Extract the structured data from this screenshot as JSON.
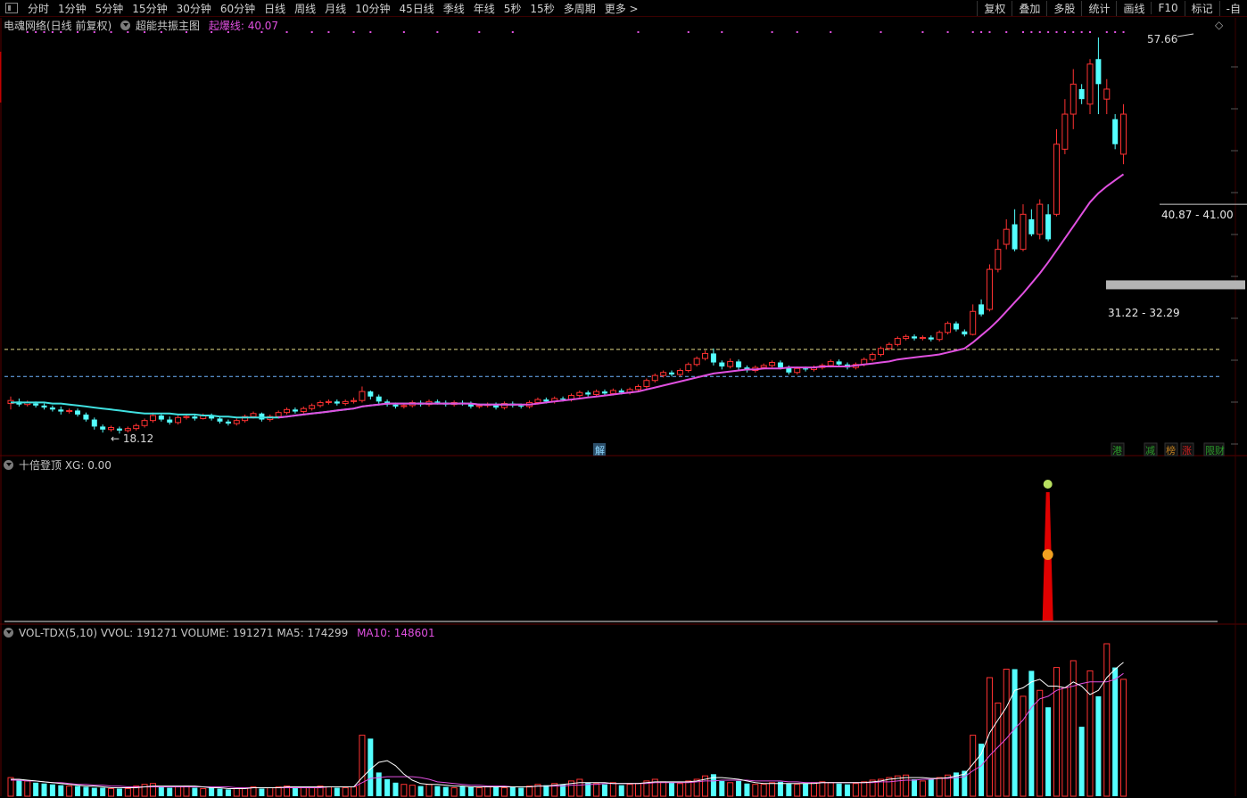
{
  "toolbar": {
    "periods": [
      "分时",
      "1分钟",
      "5分钟",
      "15分钟",
      "30分钟",
      "60分钟",
      "日线",
      "周线",
      "月线",
      "10分钟",
      "45日线",
      "季线",
      "年线",
      "5秒",
      "15秒",
      "多周期",
      "更多 >"
    ],
    "right_items": [
      "复权",
      "叠加",
      "多股",
      "统计",
      "画线",
      "F10",
      "标记",
      "-自"
    ]
  },
  "main_panel": {
    "stock_label": "电魂网络(日线 前复权)",
    "indicator_name": "超能共振主图",
    "indicator_value_label": "起爆线: 40.07"
  },
  "sub_panel": {
    "indicator_label": "十倍登顶  XG: 0.00"
  },
  "volume_panel": {
    "label_main": "VOL-TDX(5,10)  VVOL: 191271  VOLUME: 191271  MA5: 174299",
    "label_ma10": "MA10: 148601"
  },
  "markers": {
    "bottom_left": "解",
    "bottom_right": [
      "港",
      "减",
      "榜",
      "涨",
      "限财"
    ]
  },
  "colors": {
    "up": "#ff3232",
    "down": "#54ffff",
    "ma_pink": "#e050e0",
    "ma_cyan": "#40e0e0",
    "dash_yellow": "#e8e08a",
    "dash_cyan": "#6fb6ff",
    "zone_gray": "#b4b4b4",
    "vol_ma5": "#ffffff",
    "vol_ma10": "#e050e0",
    "label_magenta": "#e050e0"
  },
  "chart_data": {
    "type": "candlestick",
    "price_annotations": {
      "high_label": "57.66",
      "low_label": "18.12",
      "zone_upper": "40.87 - 41.00",
      "zone_lower": "31.22 - 32.29"
    },
    "ylim": [
      15,
      60
    ],
    "reference_lines": [
      26.5,
      23.8
    ],
    "candles": [
      [
        21.1,
        21.4,
        20.5,
        21.8
      ],
      [
        21.3,
        21.0,
        20.8,
        21.6
      ],
      [
        21.0,
        21.2,
        20.8,
        21.4
      ],
      [
        21.1,
        20.9,
        20.7,
        21.3
      ],
      [
        20.9,
        20.7,
        20.5,
        21.1
      ],
      [
        20.7,
        20.5,
        20.3,
        20.9
      ],
      [
        20.5,
        20.3,
        20.0,
        20.8
      ],
      [
        20.3,
        20.4,
        20.1,
        20.6
      ],
      [
        20.4,
        20.0,
        19.8,
        20.6
      ],
      [
        20.0,
        19.5,
        19.3,
        20.2
      ],
      [
        19.5,
        18.8,
        18.5,
        19.7
      ],
      [
        18.8,
        18.5,
        18.2,
        19.0
      ],
      [
        18.5,
        18.7,
        18.3,
        18.9
      ],
      [
        18.6,
        18.4,
        18.1,
        18.8
      ],
      [
        18.4,
        18.6,
        18.2,
        18.8
      ],
      [
        18.6,
        18.9,
        18.4,
        19.1
      ],
      [
        18.9,
        19.4,
        18.7,
        19.6
      ],
      [
        19.4,
        19.9,
        19.2,
        20.2
      ],
      [
        19.9,
        19.5,
        19.3,
        20.1
      ],
      [
        19.5,
        19.2,
        19.0,
        19.8
      ],
      [
        19.2,
        19.7,
        19.0,
        19.9
      ],
      [
        19.7,
        19.8,
        19.5,
        20.0
      ],
      [
        19.8,
        19.6,
        19.4,
        20.0
      ],
      [
        19.6,
        19.9,
        19.5,
        20.1
      ],
      [
        19.9,
        19.6,
        19.4,
        20.1
      ],
      [
        19.6,
        19.3,
        19.1,
        19.8
      ],
      [
        19.3,
        19.1,
        18.9,
        19.5
      ],
      [
        19.1,
        19.4,
        18.9,
        19.6
      ],
      [
        19.4,
        19.8,
        19.2,
        20.0
      ],
      [
        19.8,
        20.1,
        19.6,
        20.3
      ],
      [
        20.1,
        19.5,
        19.3,
        20.2
      ],
      [
        19.5,
        19.8,
        19.3,
        20.0
      ],
      [
        19.8,
        20.2,
        19.6,
        20.4
      ],
      [
        20.2,
        20.5,
        20.0,
        20.7
      ],
      [
        20.5,
        20.3,
        20.1,
        20.7
      ],
      [
        20.3,
        20.6,
        20.1,
        20.8
      ],
      [
        20.6,
        20.9,
        20.4,
        21.1
      ],
      [
        20.9,
        21.2,
        20.7,
        21.4
      ],
      [
        21.2,
        21.3,
        21.0,
        21.5
      ],
      [
        21.3,
        21.1,
        20.9,
        21.5
      ],
      [
        21.1,
        21.3,
        20.9,
        21.5
      ],
      [
        21.3,
        21.4,
        21.1,
        21.7
      ],
      [
        21.4,
        22.3,
        21.2,
        22.8
      ],
      [
        22.3,
        21.8,
        21.5,
        22.4
      ],
      [
        21.8,
        21.3,
        21.1,
        22.0
      ],
      [
        21.3,
        21.0,
        20.8,
        21.5
      ],
      [
        21.0,
        20.8,
        20.6,
        21.2
      ],
      [
        20.8,
        20.9,
        20.6,
        21.1
      ],
      [
        20.9,
        21.2,
        20.7,
        21.4
      ],
      [
        21.2,
        21.0,
        20.8,
        21.4
      ],
      [
        21.0,
        21.3,
        20.8,
        21.5
      ],
      [
        21.3,
        21.2,
        21.0,
        21.5
      ],
      [
        21.2,
        21.0,
        20.8,
        21.4
      ],
      [
        21.0,
        21.2,
        20.8,
        21.4
      ],
      [
        21.2,
        21.1,
        20.9,
        21.4
      ],
      [
        21.1,
        20.8,
        20.6,
        21.3
      ],
      [
        20.8,
        20.9,
        20.6,
        21.1
      ],
      [
        20.9,
        21.0,
        20.7,
        21.2
      ],
      [
        21.0,
        20.7,
        20.5,
        21.2
      ],
      [
        20.7,
        21.1,
        20.5,
        21.3
      ],
      [
        21.1,
        20.9,
        20.7,
        21.3
      ],
      [
        20.9,
        20.8,
        20.6,
        21.1
      ],
      [
        20.8,
        21.2,
        20.6,
        21.4
      ],
      [
        21.2,
        21.5,
        21.0,
        21.7
      ],
      [
        21.5,
        21.3,
        21.1,
        21.7
      ],
      [
        21.3,
        21.6,
        21.1,
        21.8
      ],
      [
        21.6,
        21.5,
        21.3,
        21.8
      ],
      [
        21.5,
        21.9,
        21.3,
        22.1
      ],
      [
        21.9,
        22.2,
        21.7,
        22.4
      ],
      [
        22.2,
        22.0,
        21.8,
        22.4
      ],
      [
        22.0,
        22.3,
        21.8,
        22.5
      ],
      [
        22.3,
        22.1,
        21.9,
        22.5
      ],
      [
        22.1,
        22.4,
        21.9,
        22.6
      ],
      [
        22.4,
        22.2,
        22.0,
        22.6
      ],
      [
        22.2,
        22.5,
        22.0,
        22.7
      ],
      [
        22.5,
        22.8,
        22.3,
        23.0
      ],
      [
        22.8,
        23.4,
        22.6,
        23.6
      ],
      [
        23.4,
        23.9,
        23.2,
        24.1
      ],
      [
        23.9,
        24.2,
        23.7,
        24.4
      ],
      [
        24.2,
        24.0,
        23.8,
        24.4
      ],
      [
        24.0,
        24.4,
        23.8,
        24.6
      ],
      [
        24.4,
        25.0,
        24.2,
        25.2
      ],
      [
        25.0,
        25.6,
        24.8,
        25.8
      ],
      [
        25.6,
        26.1,
        25.4,
        26.4
      ],
      [
        26.1,
        25.2,
        24.9,
        26.6
      ],
      [
        25.2,
        24.8,
        24.5,
        25.4
      ],
      [
        24.8,
        25.3,
        24.6,
        25.6
      ],
      [
        25.3,
        24.7,
        24.4,
        25.5
      ],
      [
        24.7,
        24.4,
        24.2,
        24.9
      ],
      [
        24.4,
        24.7,
        24.2,
        24.9
      ],
      [
        24.7,
        24.9,
        24.5,
        25.1
      ],
      [
        24.9,
        25.2,
        24.7,
        25.4
      ],
      [
        25.2,
        24.7,
        24.5,
        25.4
      ],
      [
        24.7,
        24.2,
        24.0,
        24.9
      ],
      [
        24.2,
        24.6,
        24.0,
        24.8
      ],
      [
        24.6,
        24.5,
        24.3,
        24.8
      ],
      [
        24.5,
        24.7,
        24.3,
        24.9
      ],
      [
        24.7,
        24.9,
        24.5,
        25.1
      ],
      [
        24.9,
        25.3,
        24.7,
        25.5
      ],
      [
        25.3,
        25.0,
        24.8,
        25.5
      ],
      [
        25.0,
        24.7,
        24.5,
        25.2
      ],
      [
        24.7,
        25.0,
        24.5,
        25.2
      ],
      [
        25.0,
        25.5,
        24.8,
        25.7
      ],
      [
        25.5,
        26.0,
        25.3,
        26.2
      ],
      [
        26.0,
        26.6,
        25.8,
        26.8
      ],
      [
        26.6,
        27.0,
        26.4,
        27.2
      ],
      [
        27.0,
        27.6,
        26.8,
        27.8
      ],
      [
        27.6,
        27.8,
        27.4,
        28.0
      ],
      [
        27.8,
        27.6,
        27.4,
        28.0
      ],
      [
        27.6,
        27.7,
        27.4,
        27.9
      ],
      [
        27.7,
        27.5,
        27.3,
        27.9
      ],
      [
        27.5,
        28.2,
        27.3,
        28.4
      ],
      [
        28.2,
        29.1,
        28.0,
        29.3
      ],
      [
        29.1,
        28.5,
        28.3,
        29.3
      ],
      [
        28.3,
        28.0,
        27.8,
        28.5
      ],
      [
        28.0,
        30.3,
        27.9,
        31.0
      ],
      [
        31.0,
        30.0,
        29.8,
        31.5
      ],
      [
        30.5,
        34.5,
        30.3,
        35.0
      ],
      [
        34.5,
        36.5,
        34.2,
        37.5
      ],
      [
        37.0,
        38.5,
        36.5,
        39.5
      ],
      [
        39.0,
        36.5,
        36.3,
        40.5
      ],
      [
        36.5,
        40.0,
        36.3,
        41.0
      ],
      [
        39.5,
        38.0,
        37.8,
        40.5
      ],
      [
        38.0,
        41.0,
        37.5,
        41.5
      ],
      [
        40.0,
        37.5,
        37.3,
        41.0
      ],
      [
        40.0,
        47.0,
        39.8,
        48.5
      ],
      [
        46.5,
        50.0,
        46.0,
        51.5
      ],
      [
        50.0,
        53.0,
        48.5,
        54.5
      ],
      [
        52.5,
        51.5,
        51.0,
        53.0
      ],
      [
        51.0,
        55.0,
        50.0,
        55.5
      ],
      [
        55.5,
        53.0,
        50.0,
        57.66
      ],
      [
        51.5,
        52.5,
        50.0,
        53.5
      ],
      [
        49.5,
        47.0,
        46.5,
        50.0
      ],
      [
        46.0,
        50.0,
        45.0,
        51.0
      ]
    ],
    "ma_line": [
      21.2,
      21.2,
      21.2,
      21.2,
      21.2,
      21.1,
      21.1,
      21.0,
      20.9,
      20.8,
      20.7,
      20.6,
      20.5,
      20.4,
      20.3,
      20.2,
      20.1,
      20.1,
      20.1,
      20.1,
      20.0,
      20.0,
      20.0,
      19.9,
      19.9,
      19.8,
      19.8,
      19.7,
      19.7,
      19.7,
      19.7,
      19.7,
      19.7,
      19.8,
      19.9,
      20.0,
      20.1,
      20.2,
      20.3,
      20.4,
      20.5,
      20.6,
      20.8,
      20.9,
      21.0,
      21.1,
      21.1,
      21.1,
      21.1,
      21.1,
      21.1,
      21.1,
      21.1,
      21.1,
      21.1,
      21.1,
      21.0,
      21.0,
      21.0,
      21.0,
      21.0,
      21.0,
      21.0,
      21.1,
      21.2,
      21.3,
      21.4,
      21.5,
      21.6,
      21.7,
      21.8,
      21.9,
      22.0,
      22.1,
      22.2,
      22.3,
      22.5,
      22.7,
      22.9,
      23.1,
      23.3,
      23.5,
      23.7,
      23.9,
      24.1,
      24.2,
      24.3,
      24.4,
      24.5,
      24.5,
      24.6,
      24.6,
      24.6,
      24.7,
      24.7,
      24.7,
      24.7,
      24.8,
      24.8,
      24.8,
      24.8,
      24.9,
      25.0,
      25.1,
      25.2,
      25.3,
      25.5,
      25.6,
      25.7,
      25.8,
      25.9,
      26.0,
      26.2,
      26.4,
      26.6,
      27.2,
      27.9,
      28.6,
      29.4,
      30.3,
      31.2,
      32.1,
      33.1,
      34.1,
      35.2,
      36.4,
      37.6,
      38.8,
      40.0,
      41.2,
      42.1,
      42.8,
      43.4,
      44.0
    ],
    "ma_cyan_until": 61,
    "signal_bar": {
      "index": 115,
      "label": ""
    },
    "volume": {
      "values": [
        22,
        20,
        18,
        16,
        15,
        14,
        13,
        12,
        12,
        11,
        10,
        10,
        9,
        9,
        9,
        12,
        14,
        15,
        12,
        10,
        11,
        12,
        10,
        9,
        10,
        9,
        8,
        9,
        10,
        11,
        9,
        10,
        11,
        12,
        11,
        10,
        11,
        12,
        11,
        10,
        10,
        11,
        72,
        68,
        28,
        20,
        16,
        14,
        13,
        12,
        14,
        12,
        11,
        10,
        12,
        11,
        10,
        11,
        12,
        10,
        11,
        10,
        12,
        14,
        13,
        15,
        14,
        18,
        20,
        16,
        15,
        14,
        16,
        13,
        14,
        15,
        18,
        20,
        17,
        16,
        15,
        18,
        20,
        24,
        26,
        18,
        16,
        18,
        15,
        14,
        14,
        16,
        17,
        15,
        14,
        15,
        16,
        17,
        16,
        15,
        14,
        15,
        17,
        19,
        20,
        22,
        24,
        25,
        20,
        18,
        20,
        22,
        25,
        28,
        30,
        72,
        62,
        140,
        110,
        150,
        150,
        118,
        148,
        125,
        105,
        152,
        128,
        160,
        82,
        148,
        118,
        180,
        152,
        138
      ],
      "ma5": [
        20,
        20,
        19,
        18,
        17,
        16,
        15,
        14,
        13,
        12,
        12,
        11,
        10,
        10,
        10,
        10,
        11,
        12,
        12,
        12,
        12,
        12,
        12,
        11,
        10,
        10,
        9,
        9,
        9,
        10,
        10,
        10,
        10,
        11,
        11,
        11,
        11,
        11,
        11,
        11,
        11,
        11,
        22,
        32,
        40,
        42,
        36,
        26,
        19,
        15,
        14,
        14,
        13,
        12,
        12,
        11,
        11,
        11,
        11,
        11,
        11,
        11,
        11,
        12,
        12,
        13,
        14,
        15,
        16,
        16,
        16,
        16,
        15,
        15,
        15,
        15,
        16,
        17,
        17,
        17,
        17,
        17,
        18,
        20,
        22,
        22,
        21,
        20,
        18,
        16,
        15,
        15,
        15,
        15,
        15,
        15,
        15,
        16,
        16,
        16,
        16,
        16,
        16,
        17,
        18,
        20,
        21,
        22,
        22,
        22,
        21,
        21,
        22,
        24,
        26,
        38,
        50,
        75,
        90,
        105,
        125,
        128,
        135,
        138,
        130,
        130,
        128,
        135,
        130,
        120,
        125,
        140,
        150,
        158
      ],
      "ma10": [
        19,
        19,
        18,
        18,
        17,
        16,
        16,
        15,
        14,
        14,
        13,
        13,
        12,
        12,
        11,
        11,
        11,
        11,
        11,
        11,
        11,
        11,
        11,
        11,
        11,
        11,
        11,
        10,
        10,
        10,
        10,
        10,
        10,
        10,
        10,
        10,
        10,
        10,
        11,
        11,
        11,
        11,
        16,
        21,
        22,
        23,
        23,
        23,
        23,
        22,
        20,
        17,
        16,
        15,
        14,
        13,
        13,
        12,
        12,
        12,
        11,
        11,
        11,
        12,
        12,
        12,
        12,
        13,
        13,
        14,
        14,
        15,
        15,
        15,
        15,
        15,
        15,
        16,
        16,
        16,
        16,
        16,
        17,
        18,
        18,
        19,
        19,
        19,
        19,
        18,
        18,
        18,
        18,
        17,
        17,
        16,
        16,
        16,
        16,
        16,
        16,
        16,
        16,
        16,
        17,
        17,
        18,
        19,
        19,
        20,
        20,
        21,
        21,
        22,
        23,
        30,
        36,
        48,
        58,
        68,
        80,
        90,
        105,
        115,
        118,
        125,
        128,
        130,
        133,
        135,
        135,
        135,
        138,
        145
      ],
      "ylim": [
        0,
        180
      ]
    }
  }
}
